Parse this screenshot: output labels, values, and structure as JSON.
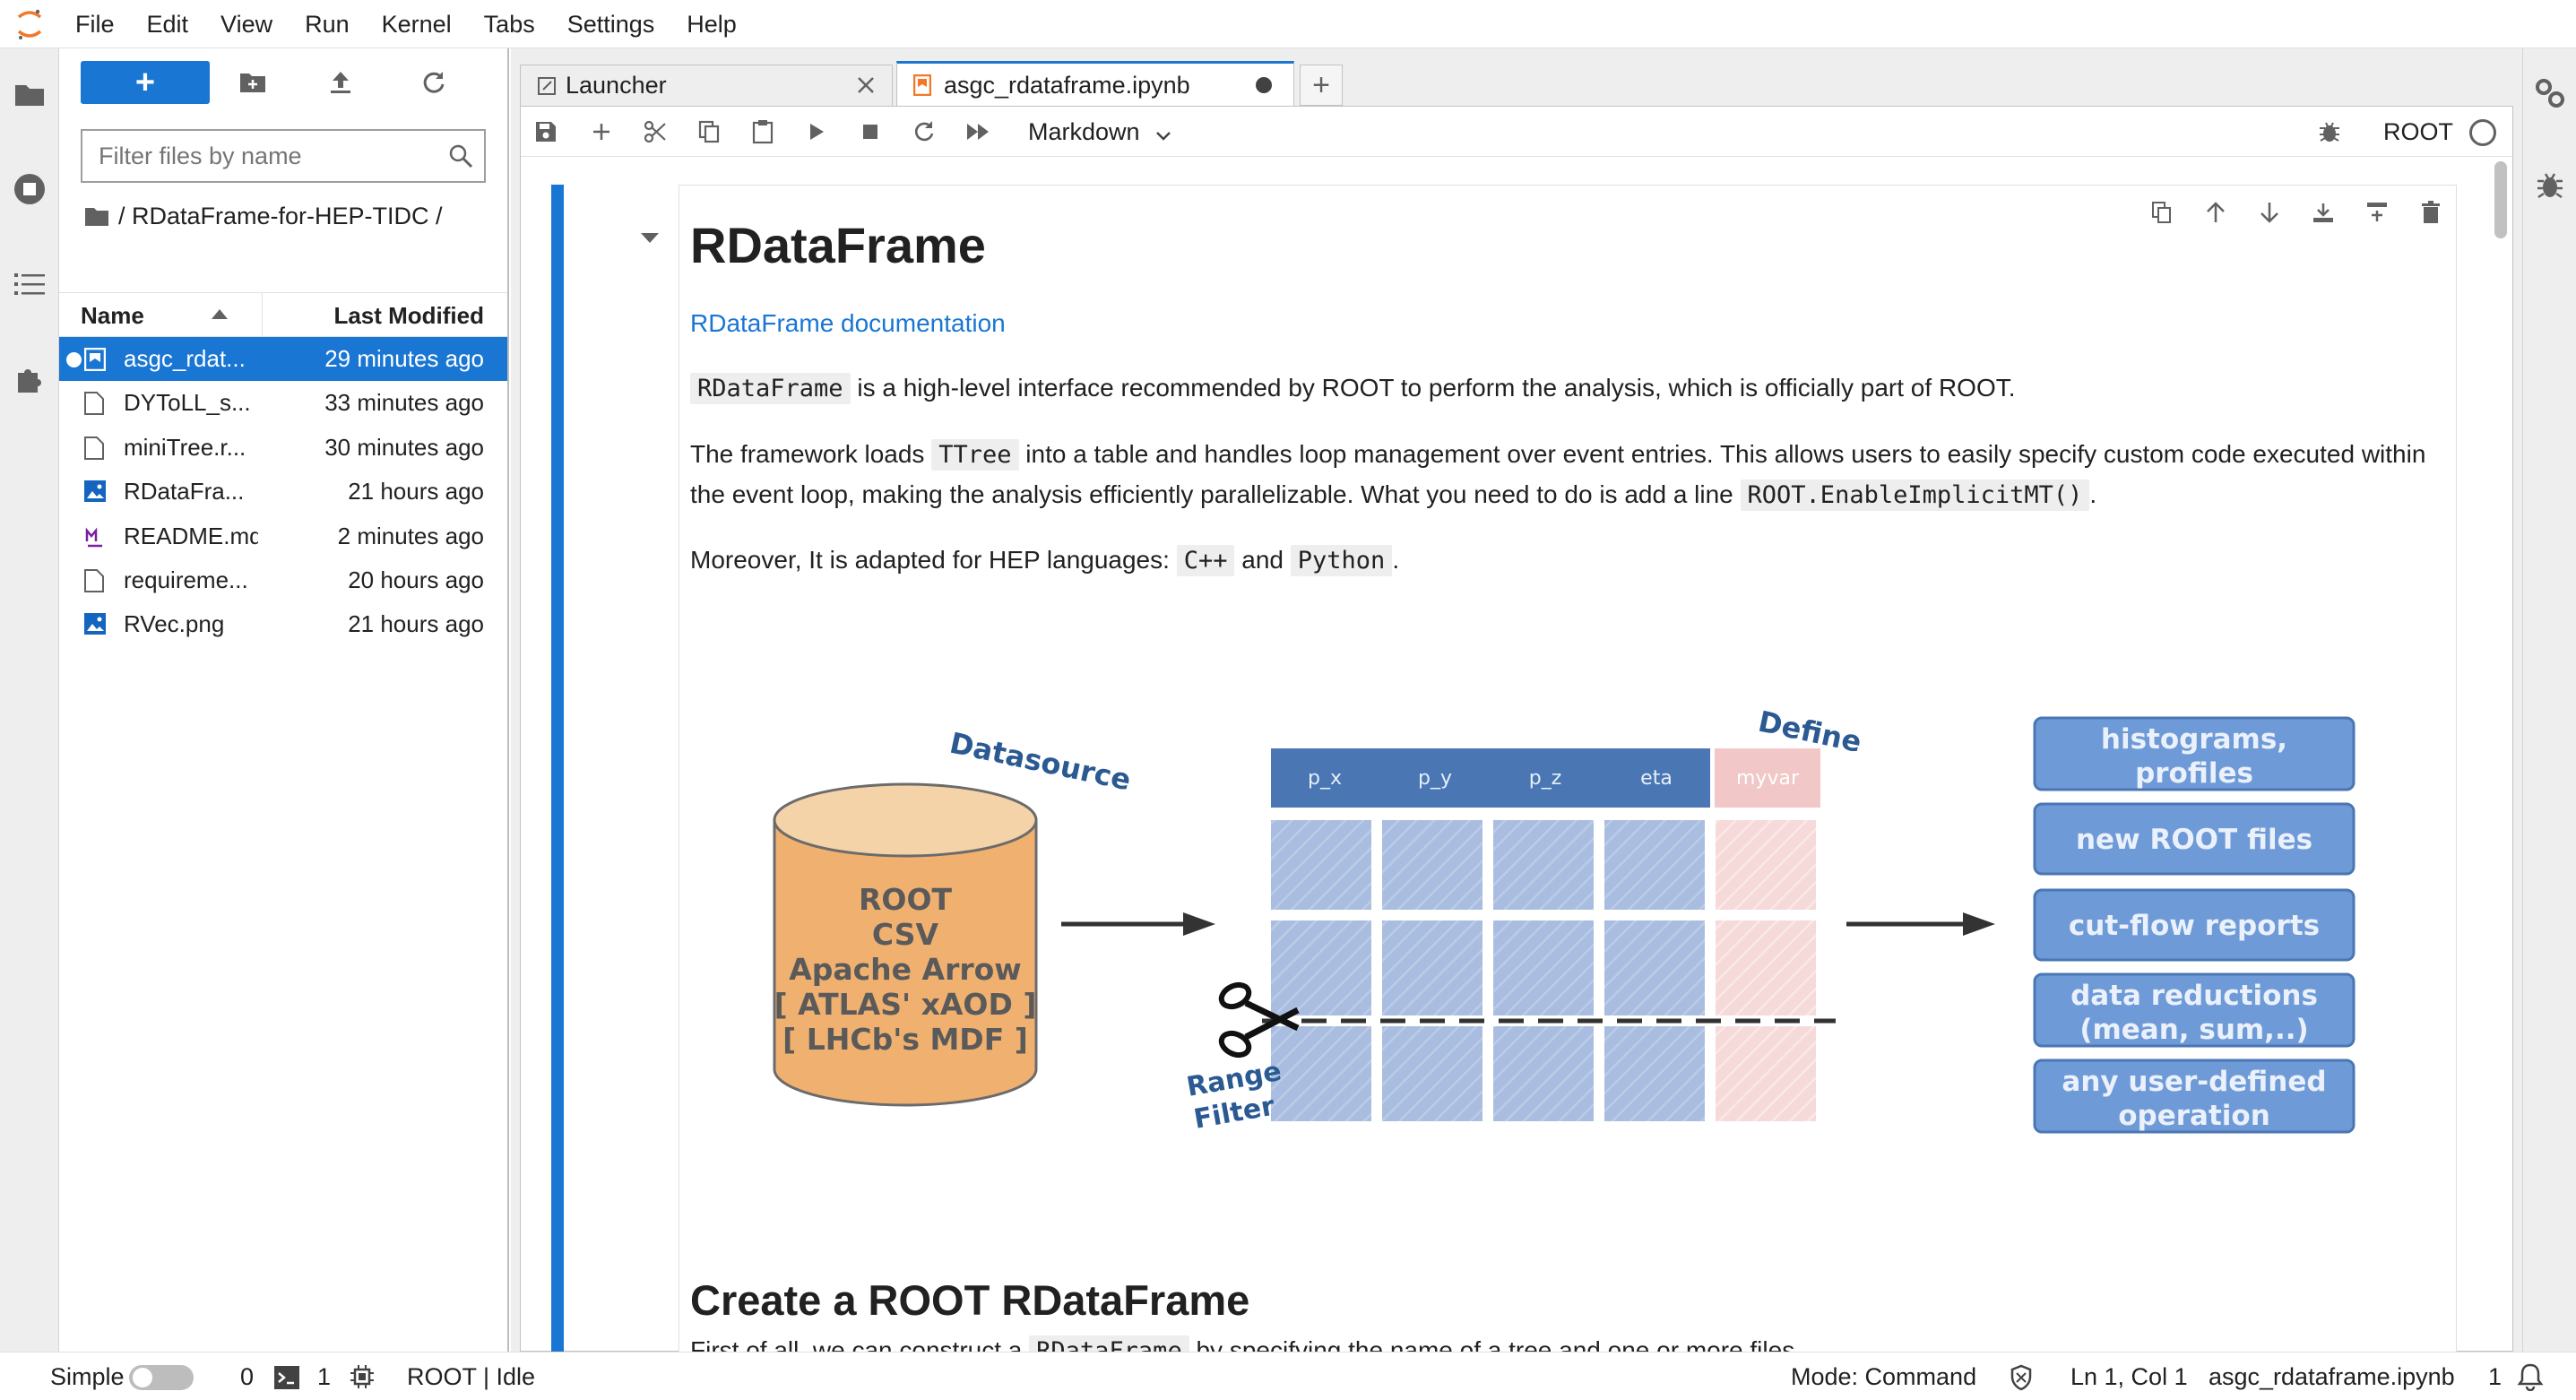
{
  "menubar": {
    "items": [
      "File",
      "Edit",
      "View",
      "Run",
      "Kernel",
      "Tabs",
      "Settings",
      "Help"
    ]
  },
  "filebrowser": {
    "new_button": "+",
    "filter_placeholder": "Filter files by name",
    "breadcrumb": "/ RDataFrame-for-HEP-TIDC /",
    "col_name": "Name",
    "col_modified": "Last Modified",
    "files": [
      {
        "name": "asgc_rdat...",
        "modified": "29 minutes ago",
        "icon": "notebook-icon",
        "selected": true,
        "running": true
      },
      {
        "name": "DYToLL_s...",
        "modified": "33 minutes ago",
        "icon": "file-icon"
      },
      {
        "name": "miniTree.r...",
        "modified": "30 minutes ago",
        "icon": "file-icon"
      },
      {
        "name": "RDataFra...",
        "modified": "21 hours ago",
        "icon": "image-icon"
      },
      {
        "name": "README.md",
        "modified": "2 minutes ago",
        "icon": "markdown-icon"
      },
      {
        "name": "requireme...",
        "modified": "20 hours ago",
        "icon": "file-icon"
      },
      {
        "name": "RVec.png",
        "modified": "21 hours ago",
        "icon": "image-icon"
      }
    ]
  },
  "tabs": [
    {
      "label": "Launcher",
      "active": false
    },
    {
      "label": "asgc_rdataframe.ipynb",
      "active": true
    }
  ],
  "toolbar": {
    "cell_type": "Markdown",
    "kernel_name": "ROOT"
  },
  "notebook": {
    "h1": "RDataFrame",
    "doc_link": "RDataFrame documentation",
    "p1_code": "RDataFrame",
    "p1_text": " is a high-level interface recommended by ROOT to perform the analysis, which is officially part of ROOT.",
    "p2_a": "The framework loads ",
    "p2_code1": "TTree",
    "p2_b": " into a table and handles loop management over event entries. This allows users to easily specify custom code executed within the event loop, making the analysis efficiently parallelizable. What you need to do is add a line ",
    "p2_code2": "ROOT.EnableImplicitMT()",
    "p2_c": ".",
    "p3_a": "Moreover, It is adapted for HEP languages: ",
    "p3_code1": "C++",
    "p3_b": " and ",
    "p3_code2": "Python",
    "p3_c": ".",
    "h2": "Create a ROOT RDataFrame",
    "p4_a": "First of all, we can construct a ",
    "p4_code": "RDataFrame",
    "p4_b": " by specifying the name of a tree and one or more files."
  },
  "diagram": {
    "datasource_label": "Datasource",
    "define_label": "Define",
    "cylinder_lines": [
      "ROOT",
      "CSV",
      "Apache Arrow",
      "[ ATLAS' xAOD ]",
      "[ LHCb's MDF ]"
    ],
    "columns": [
      "p_x",
      "p_y",
      "p_z",
      "eta",
      "myvar"
    ],
    "range_filter": [
      "Range",
      "Filter"
    ],
    "outputs": [
      [
        "histograms,",
        "profiles"
      ],
      [
        "new ROOT files"
      ],
      [
        "cut-flow reports"
      ],
      [
        "data reductions",
        "(mean, sum,..)"
      ],
      [
        "any user-defined",
        "operation"
      ]
    ]
  },
  "statusbar": {
    "mode_simple": "Simple",
    "terminals": "0",
    "kernels": "1",
    "kernel_state": "ROOT | Idle",
    "mode": "Mode: Command",
    "position": "Ln 1, Col 1",
    "filename": "asgc_rdataframe.ipynb",
    "notifications": "1"
  },
  "colors": {
    "accent": "#1976d2",
    "cylinder": "#f0b070",
    "table_blue": "#4a77b4",
    "cell_blue": "#a9bde0",
    "define_pink": "#f2c7c7",
    "output_box": "#6f9ad8"
  }
}
